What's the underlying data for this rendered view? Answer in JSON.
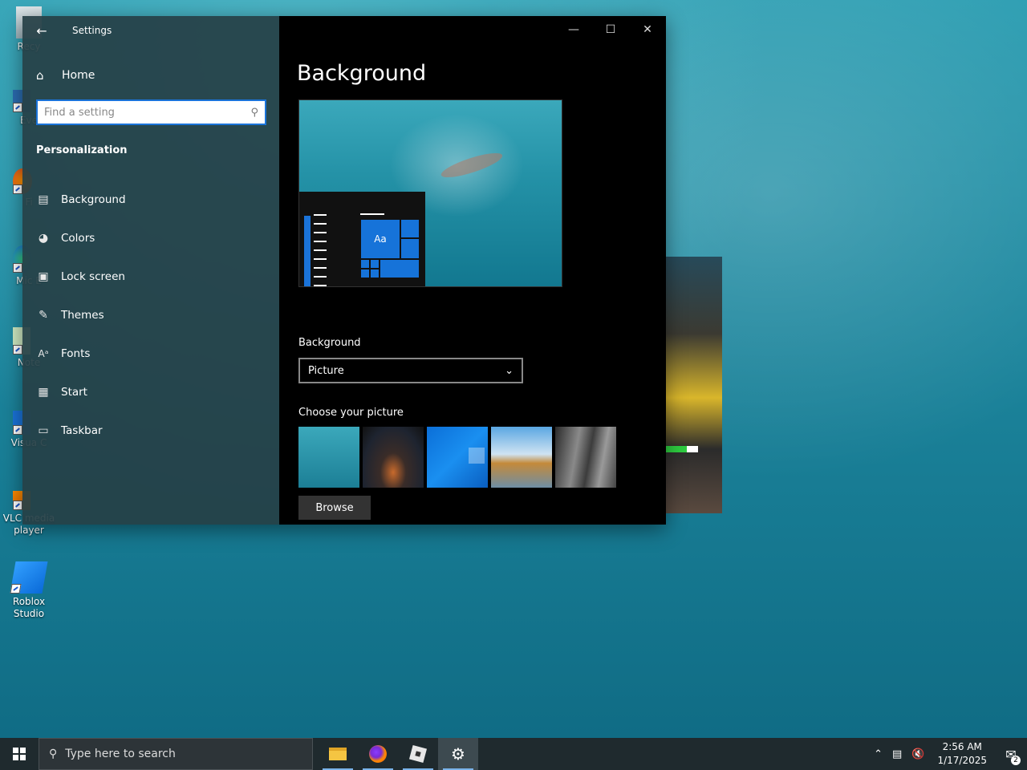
{
  "desktop": {
    "icons": [
      {
        "label": "Recy",
        "name": "recycle-bin"
      },
      {
        "label": "Eve",
        "name": "eve-shortcut"
      },
      {
        "label": "Fi",
        "name": "firefox-shortcut"
      },
      {
        "label": "Mic E",
        "name": "microsoft-edge-shortcut"
      },
      {
        "label": "Note",
        "name": "notepad-shortcut"
      },
      {
        "label": "Visua C",
        "name": "visual-studio-code-shortcut"
      },
      {
        "label": "VLC media player",
        "name": "vlc-shortcut"
      },
      {
        "label": "Roblox Studio",
        "name": "roblox-studio-shortcut"
      }
    ]
  },
  "settings": {
    "window_title": "Settings",
    "home_label": "Home",
    "search_placeholder": "Find a setting",
    "section_title": "Personalization",
    "nav": [
      {
        "label": "Background",
        "icon": "picture-icon"
      },
      {
        "label": "Colors",
        "icon": "palette-icon"
      },
      {
        "label": "Lock screen",
        "icon": "lock-screen-icon"
      },
      {
        "label": "Themes",
        "icon": "themes-icon"
      },
      {
        "label": "Fonts",
        "icon": "fonts-icon"
      },
      {
        "label": "Start",
        "icon": "start-icon"
      },
      {
        "label": "Taskbar",
        "icon": "taskbar-icon"
      }
    ],
    "content": {
      "page_title": "Background",
      "preview_tile_text": "Aa",
      "background_label": "Background",
      "background_value": "Picture",
      "choose_label": "Choose your picture",
      "browse_label": "Browse"
    }
  },
  "taskbar": {
    "search_placeholder": "Type here to search",
    "time": "2:56 AM",
    "date": "1/17/2025",
    "notification_count": "2",
    "accent_color": "#7ab4ea"
  }
}
